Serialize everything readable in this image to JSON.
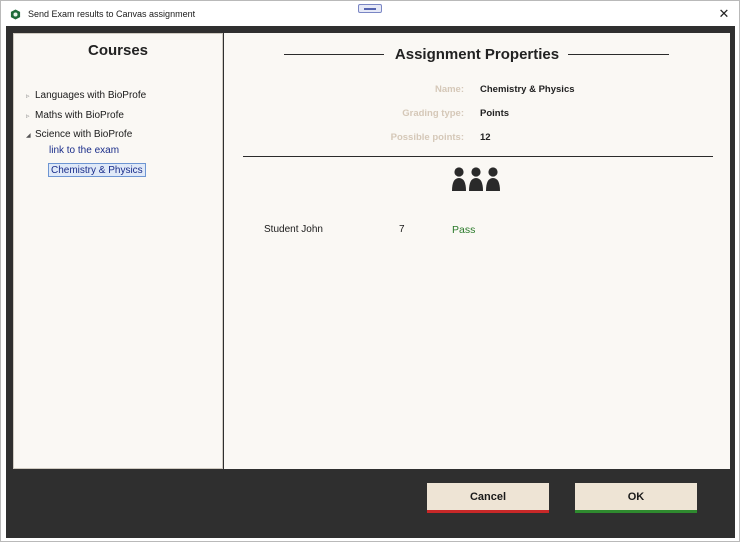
{
  "window": {
    "title": "Send Exam results to Canvas assignment",
    "close_glyph": "✕"
  },
  "courses": {
    "title": "Courses",
    "items": [
      {
        "label": "Languages with BioProfe",
        "expanded": false,
        "arrow": "▹"
      },
      {
        "label": "Maths with BioProfe",
        "expanded": false,
        "arrow": "▹"
      },
      {
        "label": "Science with BioProfe",
        "expanded": true,
        "arrow": "◢",
        "children": [
          {
            "label": "link to the exam",
            "selected": false
          },
          {
            "label": "Chemistry & Physics",
            "selected": true
          }
        ]
      }
    ]
  },
  "assignment": {
    "title": "Assignment Properties",
    "properties": [
      {
        "label": "Name:",
        "value": "Chemistry & Physics"
      },
      {
        "label": "Grading type:",
        "value": "Points"
      },
      {
        "label": "Possible points:",
        "value": "12"
      }
    ],
    "group_icon": "users-group-icon"
  },
  "students": [
    {
      "name": "Student John",
      "points": "7",
      "status": "Pass"
    }
  ],
  "buttons": {
    "cancel": "Cancel",
    "ok": "OK"
  },
  "colors": {
    "frame": "#2f2f2f",
    "panel": "#faf8f4",
    "button": "#eee4d5",
    "cancel_accent": "#c82828",
    "ok_accent": "#2f8a2f",
    "pass": "#2a7a2a",
    "link": "#1a2d8a",
    "property_label": "#d5c8b8"
  }
}
